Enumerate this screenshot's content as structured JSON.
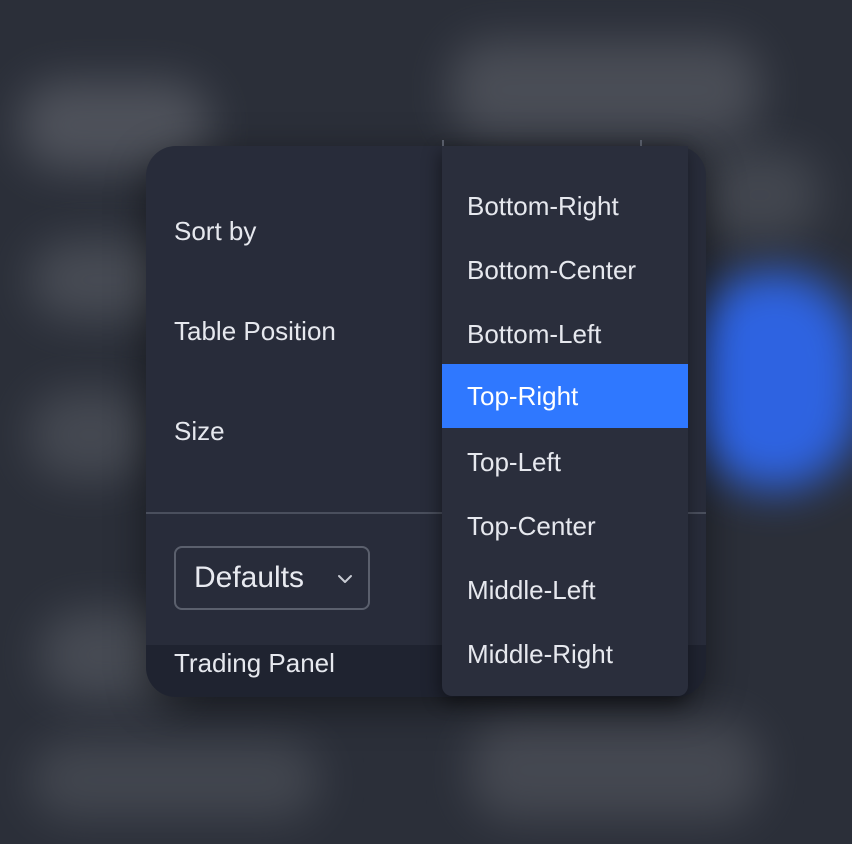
{
  "panel": {
    "rows": [
      {
        "label": "Sort by"
      },
      {
        "label": "Table Position"
      },
      {
        "label": "Size"
      }
    ],
    "defaults_select": {
      "value": "Defaults",
      "icon": "chevron-down-icon"
    },
    "footer_label": "Trading Panel"
  },
  "dropdown": {
    "options": [
      {
        "label": "Bottom-Right"
      },
      {
        "label": "Bottom-Center"
      },
      {
        "label": "Bottom-Left"
      },
      {
        "label": "Top-Right"
      },
      {
        "label": "Top-Left"
      },
      {
        "label": "Top-Center"
      },
      {
        "label": "Middle-Left"
      },
      {
        "label": "Middle-Right"
      }
    ],
    "selected_label": "Top-Right"
  },
  "colors": {
    "accent": "#2f78ff",
    "panel_bg": "#282c3a",
    "text": "#e6e8ee"
  }
}
